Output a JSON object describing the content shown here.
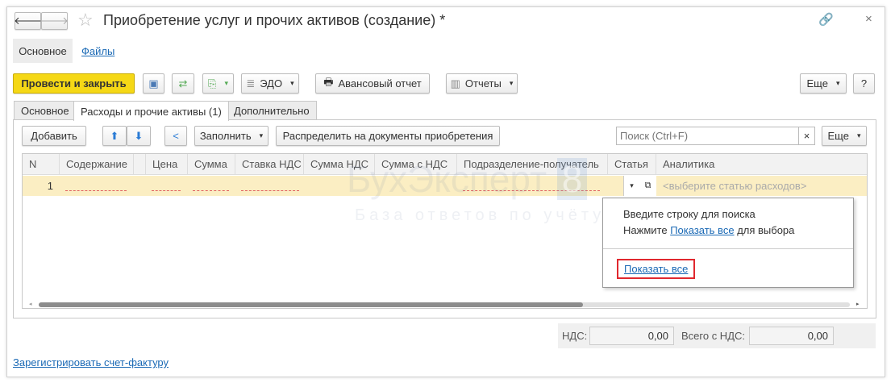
{
  "window": {
    "title": "Приобретение услуг и прочих активов (создание) *"
  },
  "nav_tabs": [
    {
      "label": "Основное"
    },
    {
      "label": "Файлы"
    }
  ],
  "toolbar": {
    "post_close": "Провести и закрыть",
    "edo": "ЭДО",
    "advance_report": "Авансовый отчет",
    "reports": "Отчеты",
    "more": "Еще",
    "help": "?"
  },
  "tabs": [
    {
      "label": "Основное"
    },
    {
      "label": "Расходы и прочие активы (1)"
    },
    {
      "label": "Дополнительно"
    }
  ],
  "table_toolbar": {
    "add": "Добавить",
    "fill": "Заполнить",
    "distribute": "Распределить на документы приобретения",
    "search_placeholder": "Поиск (Ctrl+F)",
    "clear": "×",
    "more": "Еще"
  },
  "table": {
    "columns": [
      "N",
      "Содержание",
      "",
      "Цена",
      "Сумма",
      "Ставка НДС",
      "Сумма НДС",
      "Сумма с НДС",
      "Подразделение-получатель",
      "Статья",
      "Аналитика"
    ],
    "rows": [
      {
        "n": "1",
        "analytics": "<выберите статью расходов>"
      }
    ]
  },
  "popup": {
    "line1": "Введите строку для поиска",
    "line2_pre": "Нажмите",
    "line2_link": "Показать все",
    "line2_post": "для выбора",
    "show_all": "Показать все"
  },
  "totals": {
    "vat_label": "НДС:",
    "vat": "0,00",
    "total_label": "Всего с НДС:",
    "total": "0,00"
  },
  "footer_link": "Зарегистрировать счет-фактуру",
  "watermark": {
    "brand": "БухЭксперт",
    "badge": "8",
    "tagline": "База ответов по учёту в 1С"
  },
  "colors": {
    "primary_button": "#f5d816",
    "link": "#1a69b5",
    "row_highlight": "#fbeec3",
    "highlight_box": "#e0282e"
  }
}
